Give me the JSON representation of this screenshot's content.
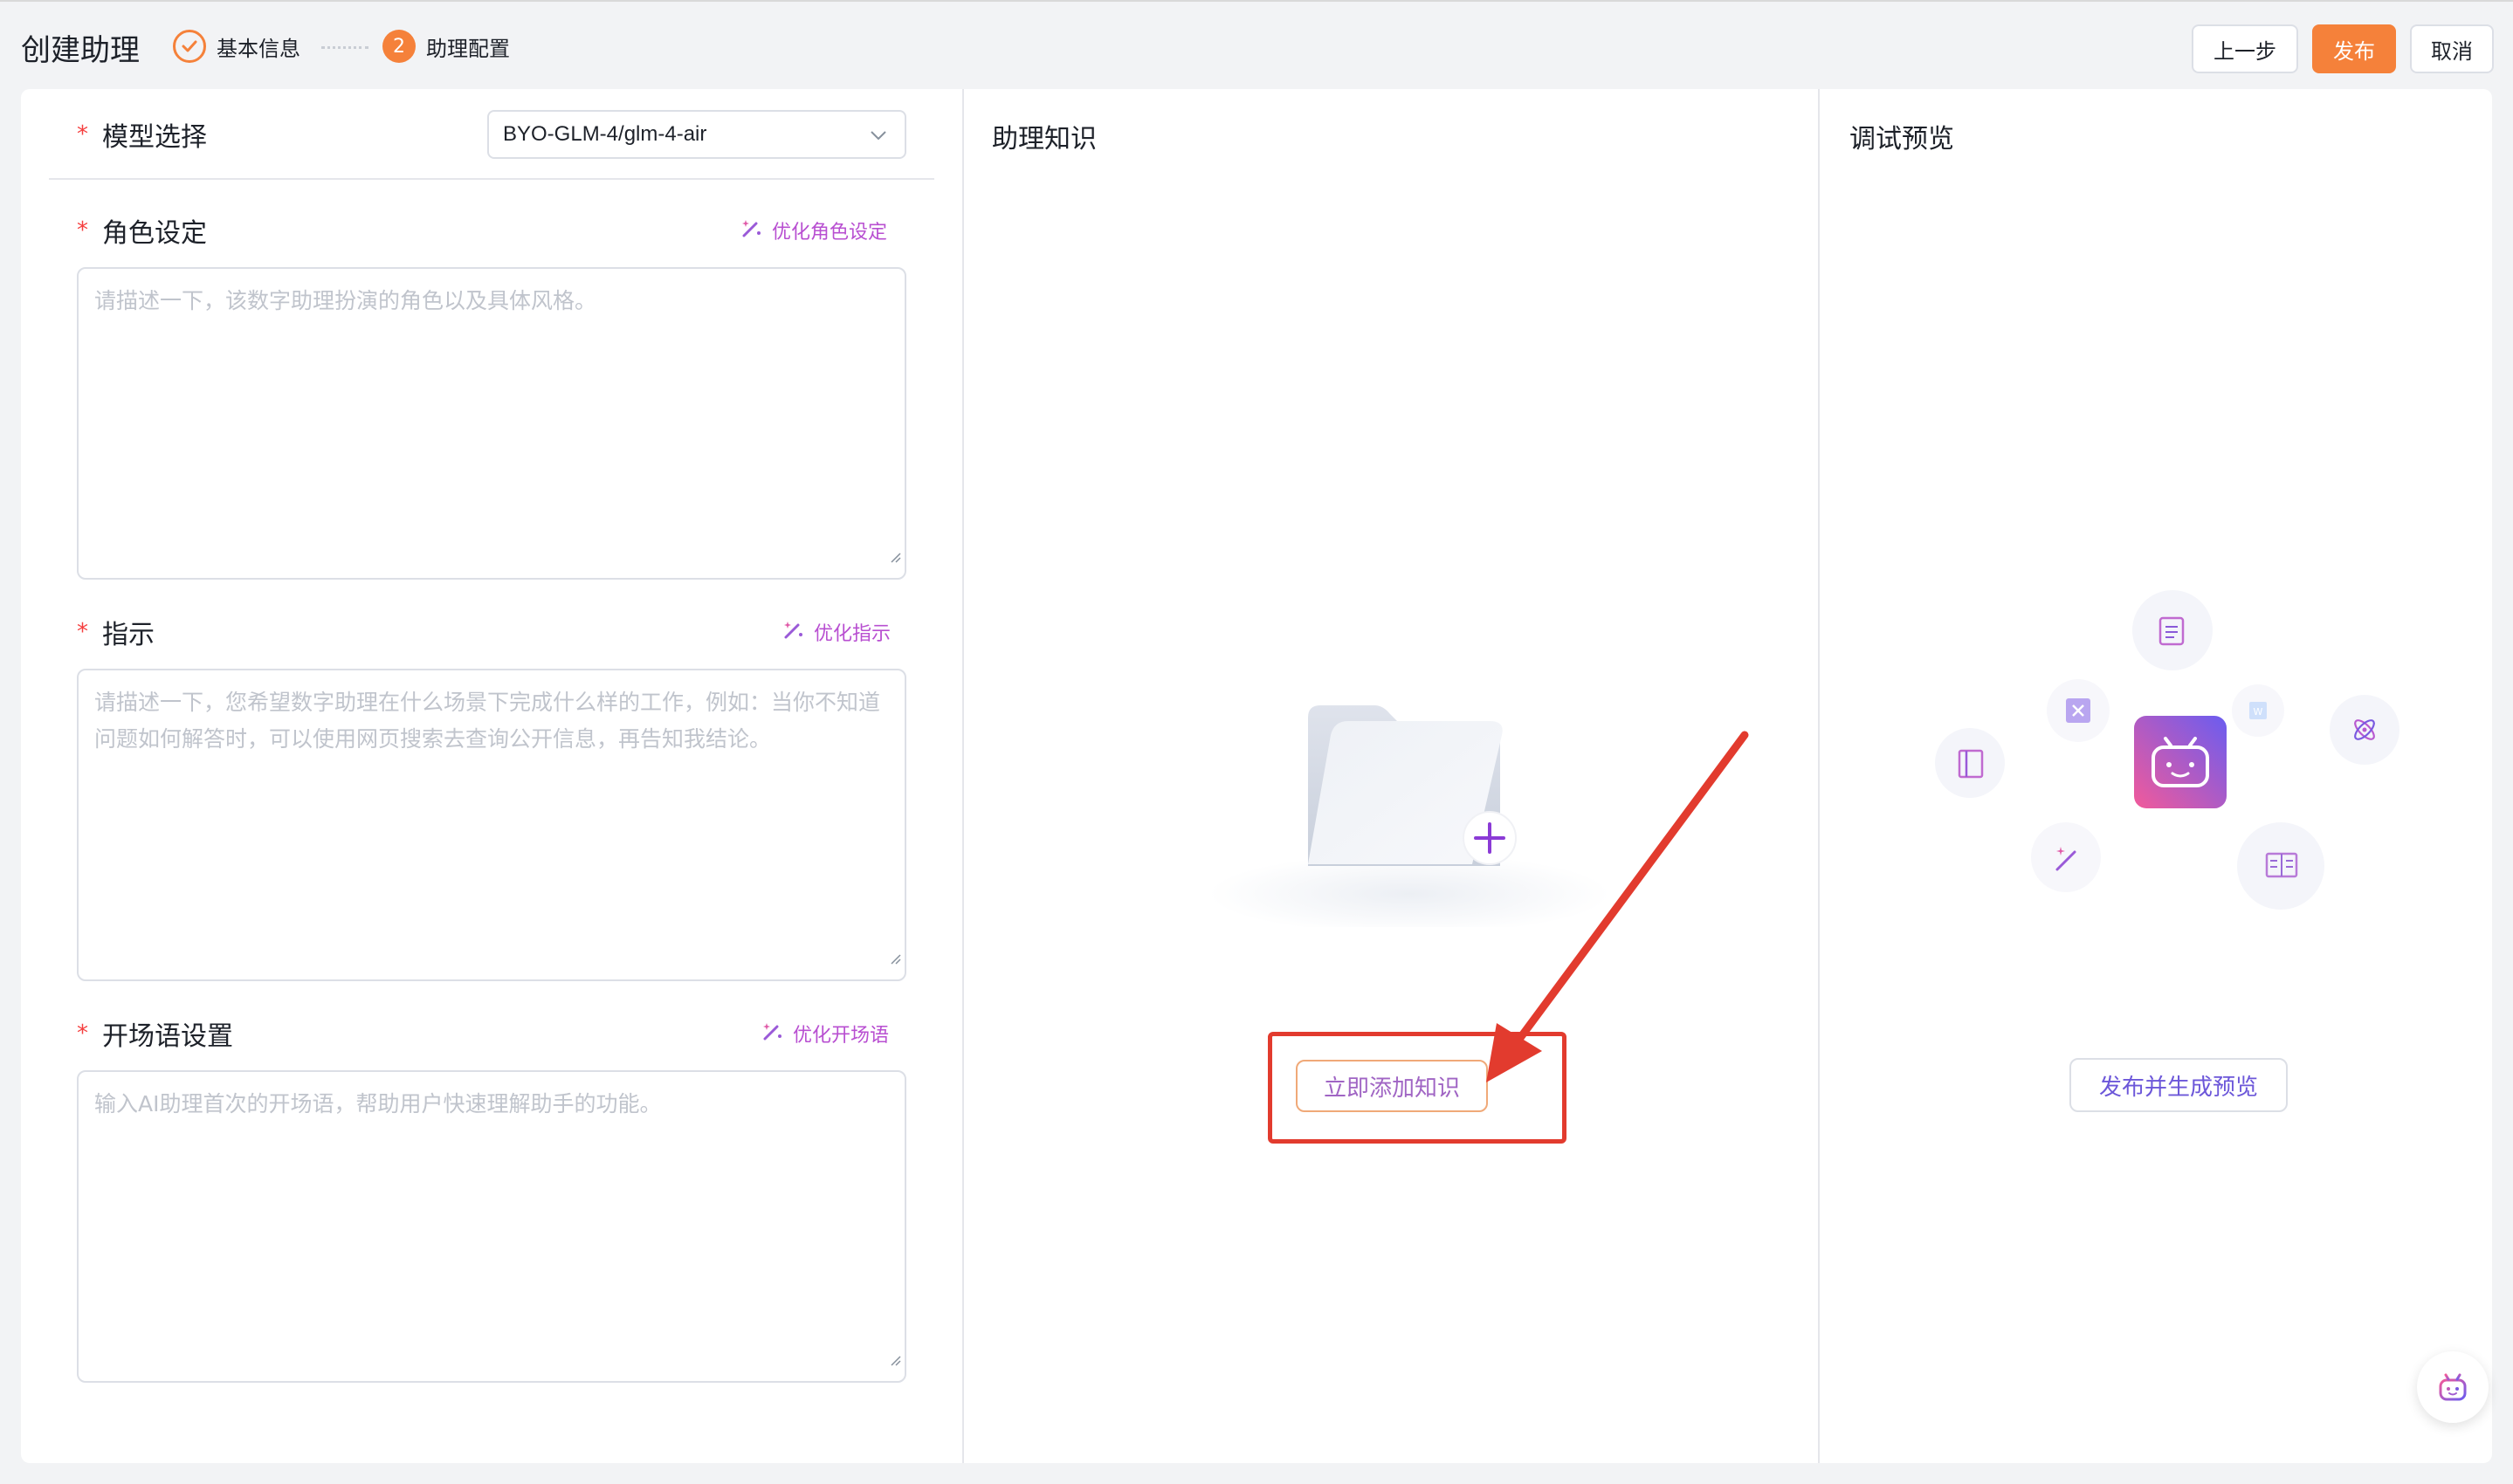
{
  "header": {
    "title": "创建助理",
    "steps": [
      {
        "label": "基本信息",
        "status": "done"
      },
      {
        "number": "2",
        "label": "助理配置",
        "status": "active"
      }
    ],
    "buttons": {
      "prev": "上一步",
      "publish": "发布",
      "cancel": "取消"
    }
  },
  "config": {
    "model": {
      "label": "模型选择",
      "value": "BYO-GLM-4/glm-4-air"
    },
    "role": {
      "label": "角色设定",
      "optimize": "优化角色设定",
      "placeholder": "请描述一下，该数字助理扮演的角色以及具体风格。"
    },
    "instruction": {
      "label": "指示",
      "optimize": "优化指示",
      "placeholder": "请描述一下，您希望数字助理在什么场景下完成什么样的工作，例如：当你不知道问题如何解答时，可以使用网页搜索去查询公开信息，再告知我结论。"
    },
    "opening": {
      "label": "开场语设置",
      "optimize": "优化开场语",
      "placeholder": "输入AI助理首次的开场语，帮助用户快速理解助手的功能。"
    },
    "required_mark": "*"
  },
  "knowledge": {
    "title": "助理知识",
    "add_button": "立即添加知识"
  },
  "preview": {
    "title": "调试预览",
    "button": "发布并生成预览"
  },
  "colors": {
    "accent": "#f5813a",
    "annotation": "#e23b2e",
    "gradient_start": "#f25a9a",
    "gradient_end": "#6a5cf0"
  },
  "icons": [
    "check-icon",
    "chevron-down-icon",
    "magic-wand-icon",
    "folder-icon",
    "plus-icon",
    "robot-icon",
    "document-icon",
    "excel-icon",
    "word-icon",
    "atom-icon",
    "notebook-icon",
    "book-icon"
  ]
}
